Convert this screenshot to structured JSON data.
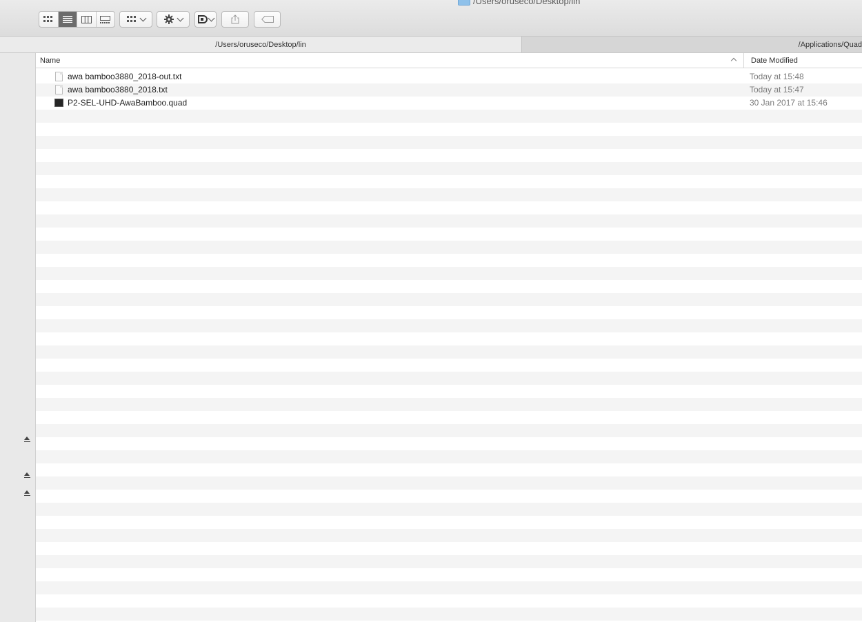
{
  "window": {
    "title": "/Users/oruseco/Desktop/lin"
  },
  "toolbar": {
    "view_modes": [
      {
        "name": "icon-view",
        "active": false
      },
      {
        "name": "list-view",
        "active": true
      },
      {
        "name": "column-view",
        "active": false
      },
      {
        "name": "gallery-view",
        "active": false
      }
    ],
    "icons": [
      "group-by-icon",
      "gear-icon",
      "dropbox-icon",
      "share-icon",
      "tag-icon"
    ]
  },
  "pathbar": {
    "left_path": "/Users/oruseco/Desktop/lin",
    "right_path": "/Applications/Quad"
  },
  "list": {
    "headers": {
      "name": "Name",
      "date": "Date Modified"
    },
    "files": [
      {
        "name": "awa bamboo3880_2018-out.txt",
        "date": "Today at 15:48",
        "icon": "text-document-icon"
      },
      {
        "name": "awa bamboo3880_2018.txt",
        "date": "Today at 15:47",
        "icon": "text-document-icon"
      },
      {
        "name": "P2-SEL-UHD-AwaBamboo.quad",
        "date": "30 Jan 2017 at 15:46",
        "icon": "terminal-document-icon"
      }
    ]
  },
  "colors": {
    "toolbar_bg": "#e2e2e2",
    "stripe": "#f4f4f4",
    "date_text": "#7b7b7b"
  }
}
